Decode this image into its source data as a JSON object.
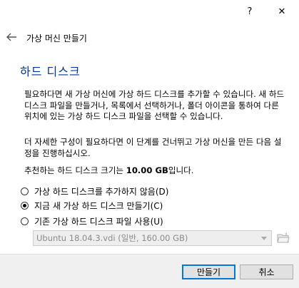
{
  "titlebar": {
    "help": "?",
    "close": "✕"
  },
  "wizard_title": "가상 머신 만들기",
  "page_heading": "하드 디스크",
  "paragraph1": "필요하다면 새 가상 머신에 가상 하드 디스크를 추가할 수 있습니다. 새 하드 디스크 파일을 만들거나, 목록에서 선택하거나, 폴더 아이콘을 통하여 다른 위치에 있는 가상 하드 디스크 파일을 선택할 수 있습니다.",
  "paragraph2": "더 자세한 구성이 필요하다면 이 단계를 건너뛰고 가상 머신을 만든 다음 설정을 진행하십시오.",
  "recommend": {
    "prefix": "추천하는 하드 디스크 크기는 ",
    "size": "10.00 GB",
    "suffix": "입니다."
  },
  "options": [
    {
      "label": "가상 하드 디스크를 추가하지 않음(D)",
      "checked": false
    },
    {
      "label": "지금 새 가상 하드 디스크 만들기(C)",
      "checked": true
    },
    {
      "label": "기존 가상 하드 디스크 파일 사용(U)",
      "checked": false
    }
  ],
  "existing_disk": {
    "selected": "Ubuntu 18.04.3.vdi (일반, 160.00 GB)"
  },
  "buttons": {
    "create": "만들기",
    "cancel": "취소"
  }
}
